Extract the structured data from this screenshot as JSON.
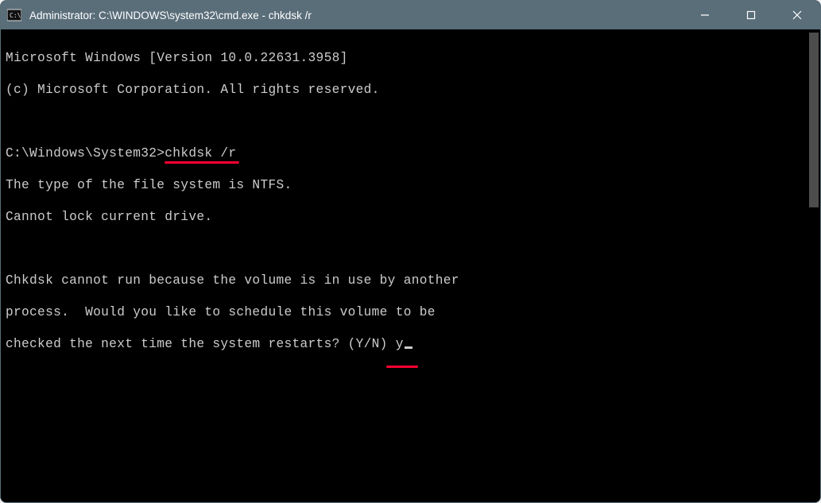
{
  "titlebar": {
    "title": "Administrator: C:\\WINDOWS\\system32\\cmd.exe - chkdsk  /r"
  },
  "terminal": {
    "line_version": "Microsoft Windows [Version 10.0.22631.3958]",
    "line_copyright": "(c) Microsoft Corporation. All rights reserved.",
    "prompt_path": "C:\\Windows\\System32>",
    "command": "chkdsk /r",
    "out_fs": "The type of the file system is NTFS.",
    "out_lock": "Cannot lock current drive.",
    "out_msg1": "Chkdsk cannot run because the volume is in use by another",
    "out_msg2": "process.  Would you like to schedule this volume to be",
    "out_msg3_prefix": "checked the next time the system restarts? (Y/N) ",
    "answer": "y"
  }
}
